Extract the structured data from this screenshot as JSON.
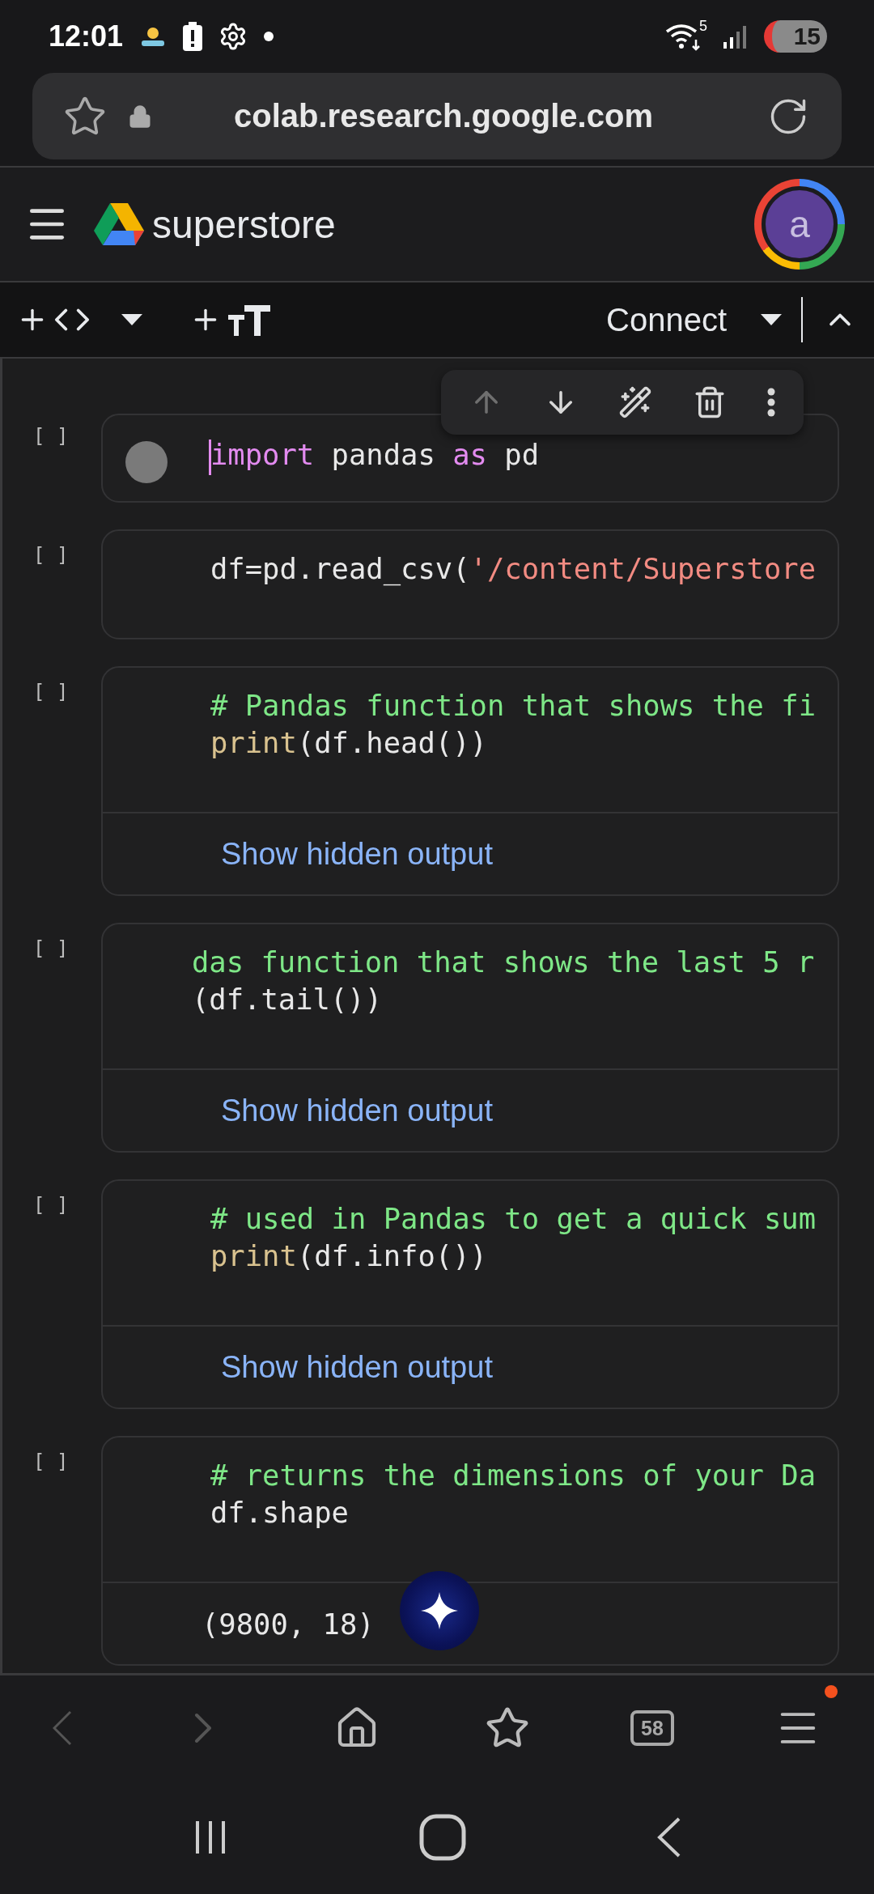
{
  "status_bar": {
    "time": "12:01",
    "battery": "15",
    "wifi_band": "5"
  },
  "address_bar": {
    "url": "colab.research.google.com"
  },
  "header": {
    "title": "superstore",
    "avatar": "a"
  },
  "toolbar": {
    "connect": "Connect"
  },
  "cell_toolbar": {
    "move_up_disabled": true
  },
  "cells": [
    {
      "bracket": "[ ]",
      "focused": true,
      "scrolled": false,
      "lines": [
        [
          {
            "kind": "keyword",
            "text": "import"
          },
          {
            "kind": "plain",
            "text": " pandas "
          },
          {
            "kind": "keyword",
            "text": "as"
          },
          {
            "kind": "plain",
            "text": " pd"
          }
        ]
      ]
    },
    {
      "bracket": "[ ]",
      "focused": false,
      "scrolled": false,
      "lines": [
        [
          {
            "kind": "plain",
            "text": "df=pd.read_csv("
          },
          {
            "kind": "string",
            "text": "'/content/Superstore"
          }
        ]
      ]
    },
    {
      "bracket": "[ ]",
      "focused": false,
      "scrolled": false,
      "lines": [
        [
          {
            "kind": "comment",
            "text": "# Pandas function that shows the fi"
          }
        ],
        [
          {
            "kind": "builtin",
            "text": "print"
          },
          {
            "kind": "plain",
            "text": "(df.head())"
          }
        ]
      ],
      "output": {
        "kind": "hidden",
        "text": "Show hidden output"
      }
    },
    {
      "bracket": "[ ]",
      "focused": false,
      "scrolled": true,
      "lines": [
        [
          {
            "kind": "comment",
            "text": "das function that shows the last 5 r"
          }
        ],
        [
          {
            "kind": "plain",
            "text": "(df.tail())"
          }
        ]
      ],
      "output": {
        "kind": "hidden",
        "text": "Show hidden output"
      }
    },
    {
      "bracket": "[ ]",
      "focused": false,
      "scrolled": false,
      "lines": [
        [
          {
            "kind": "comment",
            "text": "# used in Pandas to get a quick sum"
          }
        ],
        [
          {
            "kind": "builtin",
            "text": "print"
          },
          {
            "kind": "plain",
            "text": "(df.info())"
          }
        ]
      ],
      "output": {
        "kind": "hidden",
        "text": "Show hidden output"
      }
    },
    {
      "bracket": "[ ]",
      "focused": false,
      "scrolled": false,
      "lines": [
        [
          {
            "kind": "comment",
            "text": "# returns the dimensions of your Da"
          }
        ],
        [
          {
            "kind": "plain",
            "text": "df.shape"
          }
        ]
      ],
      "output": {
        "kind": "text",
        "text": "(9800, 18)"
      }
    }
  ],
  "browser_nav": {
    "back_disabled": true,
    "tabs_count": "58",
    "menu_badge": true
  }
}
